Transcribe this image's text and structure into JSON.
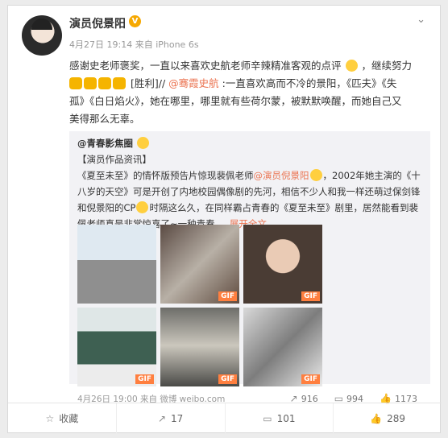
{
  "user": {
    "name": "演员倪景阳",
    "verify": "V",
    "avatar": "avatar"
  },
  "post": {
    "time": "4月27日 19:14",
    "source": "来自 iPhone 6s",
    "line1_a": "感谢史老师褒奖，一直以来喜欢史航老师辛辣精准客观的点评",
    "line1_b": "，继续努力",
    "line2_a": "[胜利]//",
    "mention": "@骞霞史航",
    "line2_b": ":一直喜欢高而不冷的景阳，《匹夫》《失",
    "line3": "孤》《白日焰火》，她在哪里，哪里就有些荷尔蒙，被默默唤醒，而她自己又",
    "line4": "美得那么无辜。"
  },
  "quote": {
    "handle": "@青春影焦圈",
    "tag": "【演员作品资讯】",
    "text1": "《夏至未至》的情怀版预告片惊现裴佩老师",
    "mention": "@演员倪景阳",
    "text2": "，2002年她主演的《十",
    "text3": "八岁的天空》可是开创了内地校园偶像剧的先河，相信不少人和我一样还萌过保剑锋",
    "text4": "和倪景阳的CP",
    "text5": "时隔这么久，在同样霸占青春的《夏至未至》剧里，居然能看到裴",
    "text6": "佩老师真是非常惊喜了~一种青春 ...",
    "expand": "展开全文",
    "time": "4月26日 19:00",
    "source": "来自 微博 weibo.com",
    "shares": "916",
    "comments": "994",
    "likes": "1173",
    "gif": "GIF"
  },
  "actions": {
    "collect": "收藏",
    "share": "17",
    "comment": "101",
    "like": "289"
  }
}
